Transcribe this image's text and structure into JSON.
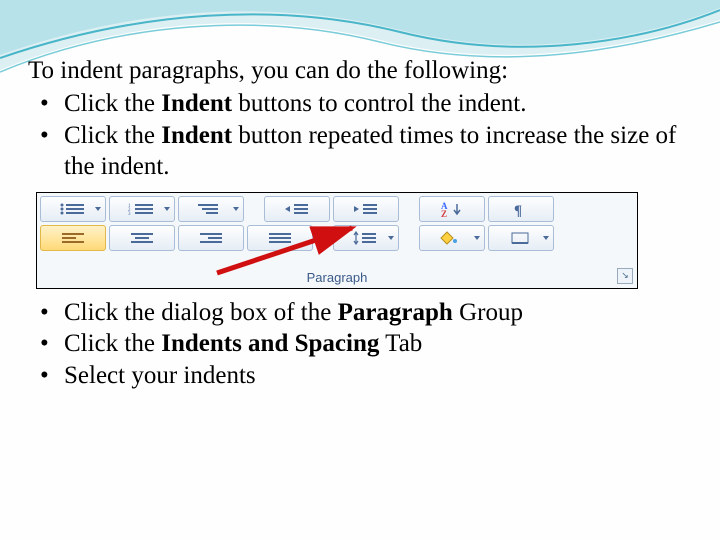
{
  "intro": "To indent paragraphs, you can do the following:",
  "bullets1": [
    {
      "pre": "Click the ",
      "bold": "Indent",
      "post": " buttons to control the indent."
    },
    {
      "pre": "Click the ",
      "bold": "Indent",
      "post": " button repeated times to increase the size of the indent."
    }
  ],
  "bullets2": [
    {
      "pre": "Click the dialog box of the ",
      "bold": "Paragraph",
      "post": " Group"
    },
    {
      "pre": "Click the ",
      "bold": "Indents and Spacing",
      "post": " Tab"
    },
    {
      "pre": "Select  your indents",
      "bold": "",
      "post": ""
    }
  ],
  "ribbon": {
    "caption": "Paragraph"
  }
}
